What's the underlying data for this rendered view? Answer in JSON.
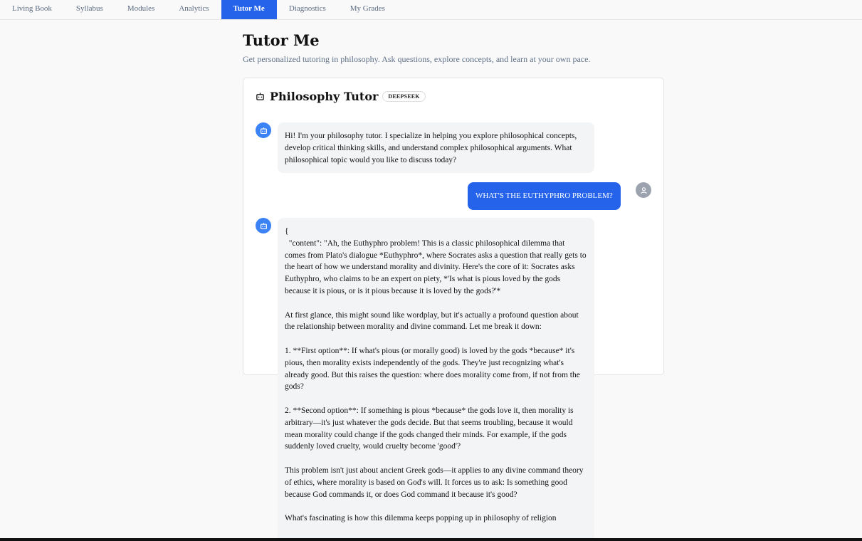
{
  "nav": {
    "tabs": [
      {
        "label": "Living Book"
      },
      {
        "label": "Syllabus"
      },
      {
        "label": "Modules"
      },
      {
        "label": "Analytics"
      },
      {
        "label": "Tutor Me",
        "active": true
      },
      {
        "label": "Diagnostics"
      },
      {
        "label": "My Grades"
      }
    ]
  },
  "header": {
    "title": "Tutor Me",
    "subtitle": "Get personalized tutoring in philosophy. Ask questions, explore concepts, and learn at your own pace."
  },
  "chat": {
    "title": "Philosophy Tutor",
    "model_badge": "DEEPSEEK",
    "messages": [
      {
        "role": "bot",
        "paragraphs": [
          "Hi! I'm your philosophy tutor. I specialize in helping you explore philosophical concepts, develop critical thinking skills, and understand complex philosophical arguments. What philosophical topic would you like to discuss today?"
        ]
      },
      {
        "role": "user",
        "text": "What's the Euthyphro problem?"
      },
      {
        "role": "bot",
        "paragraphs": [
          "{\n  \"content\": \"Ah, the Euthyphro problem! This is a classic philosophical dilemma that comes from Plato's dialogue *Euthyphro*, where Socrates asks a question that really gets to the heart of how we understand morality and divinity. Here's the core of it: Socrates asks Euthyphro, who claims to be an expert on piety, *'Is what is pious loved by the gods because it is pious, or is it pious because it is loved by the gods?'*",
          "At first glance, this might sound like wordplay, but it's actually a profound question about the relationship between morality and divine command. Let me break it down:",
          "1. **First option**: If what's pious (or morally good) is loved by the gods *because* it's pious, then morality exists independently of the gods. They're just recognizing what's already good. But this raises the question: where does morality come from, if not from the gods?",
          "2. **Second option**: If something is pious *because* the gods love it, then morality is arbitrary—it's just whatever the gods decide. But that seems troubling, because it would mean morality could change if the gods changed their minds. For example, if the gods suddenly loved cruelty, would cruelty become 'good'?",
          "This problem isn't just about ancient Greek gods—it applies to any divine command theory of ethics, where morality is based on God's will. It forces us to ask: Is something good because God commands it, or does God command it because it's good?",
          "What's fascinating is how this dilemma keeps popping up in philosophy of religion"
        ]
      }
    ]
  },
  "icons": {
    "header_icon": "robot-icon",
    "bot_avatar": "robot-icon",
    "user_avatar": "user-icon"
  },
  "colors": {
    "accent": "#2563eb",
    "bot_avatar": "#3b82f6",
    "user_avatar": "#9ca3af",
    "bot_bubble": "#f3f4f6"
  }
}
